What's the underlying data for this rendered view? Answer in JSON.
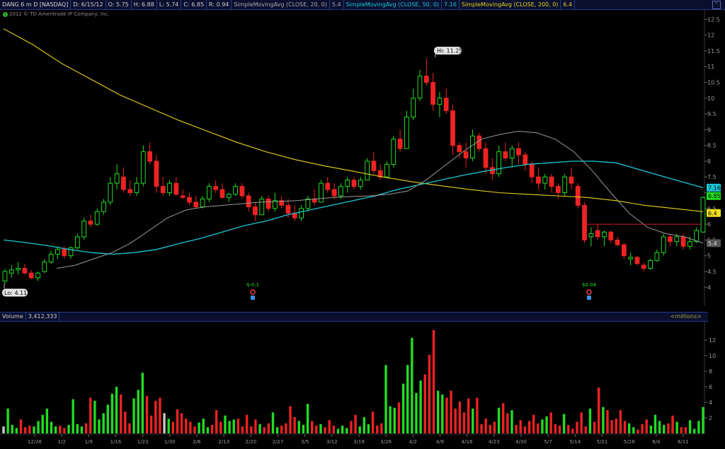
{
  "header": {
    "symbol": "DANG 6 m D [NASDAQ]",
    "date": "D: 6/15/12",
    "open": "O: 5.75",
    "high": "H: 6.88",
    "low": "L: 5.74",
    "close": "C: 6.85",
    "range": "R: 0.94",
    "sma20_label": "SimpleMovingAvg (CLOSE, 20, 0)",
    "sma20_value": "5.4",
    "sma50_label": "SimpleMovingAvg (CLOSE, 50, 0)",
    "sma50_value": "7.16",
    "sma200_label": "SimpleMovingAvg (CLOSE, 200, 0)",
    "sma200_value": "6.4",
    "copyright": "2012 © TD Ameritrade IP Company, Inc."
  },
  "volume_header": {
    "label": "Volume",
    "value": "3,412,333",
    "units": "<millions>"
  },
  "colors": {
    "up": "#22dd22",
    "down": "#ee2222",
    "sma20": "#9a9a9a",
    "sma50": "#19c7d4",
    "sma200": "#e6d21c",
    "level": "#cc2222"
  },
  "chart_data": [
    {
      "type": "line",
      "title": "DANG 6 m D [NASDAQ]",
      "xlabel": "",
      "ylabel": "",
      "x": [
        "12/26",
        "1/2",
        "1/9",
        "1/16",
        "1/23",
        "1/30",
        "2/6",
        "2/13",
        "2/20",
        "2/27",
        "3/5",
        "3/12",
        "3/19",
        "3/26",
        "4/2",
        "4/9",
        "4/16",
        "4/23",
        "4/30",
        "5/7",
        "5/14",
        "5/21",
        "5/28",
        "6/4",
        "6/11"
      ],
      "ylim": [
        3.4,
        12.8
      ],
      "yticks": [
        "4",
        "4.5",
        "5",
        "5.5",
        "6",
        "6.5",
        "7",
        "7.5",
        "8",
        "8.5",
        "9",
        "9.5",
        "10",
        "10.5",
        "11",
        "11.5",
        "12",
        "12.5"
      ],
      "candles": [
        [
          4.2,
          4.58,
          4.1,
          4.5
        ],
        [
          4.45,
          4.7,
          4.3,
          4.55
        ],
        [
          4.55,
          4.8,
          4.4,
          4.6
        ],
        [
          4.6,
          4.75,
          4.4,
          4.45
        ],
        [
          4.45,
          4.55,
          4.25,
          4.3
        ],
        [
          4.3,
          4.5,
          4.2,
          4.45
        ],
        [
          4.5,
          4.9,
          4.45,
          4.8
        ],
        [
          4.8,
          5.15,
          4.75,
          5.05
        ],
        [
          5.05,
          5.3,
          4.9,
          5.2
        ],
        [
          5.2,
          5.3,
          4.9,
          5.0
        ],
        [
          5.0,
          5.3,
          4.9,
          5.25
        ],
        [
          5.25,
          5.7,
          5.2,
          5.6
        ],
        [
          5.6,
          6.2,
          5.5,
          6.1
        ],
        [
          6.1,
          6.3,
          5.9,
          6.0
        ],
        [
          6.0,
          6.5,
          5.95,
          6.4
        ],
        [
          6.4,
          6.8,
          6.3,
          6.7
        ],
        [
          6.7,
          7.5,
          6.6,
          7.3
        ],
        [
          7.3,
          7.9,
          7.1,
          7.6
        ],
        [
          7.5,
          7.8,
          7.0,
          7.1
        ],
        [
          7.1,
          7.4,
          6.9,
          7.0
        ],
        [
          7.0,
          7.5,
          6.9,
          7.3
        ],
        [
          7.3,
          8.5,
          7.2,
          8.3
        ],
        [
          8.3,
          8.6,
          7.9,
          8.0
        ],
        [
          8.0,
          8.2,
          7.0,
          7.2
        ],
        [
          7.2,
          7.5,
          6.9,
          7.0
        ],
        [
          7.0,
          7.4,
          6.9,
          7.3
        ],
        [
          7.3,
          7.5,
          6.9,
          6.95
        ],
        [
          6.9,
          7.1,
          6.8,
          6.85
        ],
        [
          6.85,
          7.0,
          6.6,
          6.7
        ],
        [
          6.7,
          6.9,
          6.5,
          6.55
        ],
        [
          6.55,
          6.9,
          6.5,
          6.8
        ],
        [
          6.8,
          7.3,
          6.7,
          7.2
        ],
        [
          7.2,
          7.4,
          7.0,
          7.1
        ],
        [
          7.1,
          7.3,
          6.8,
          6.85
        ],
        [
          6.85,
          7.0,
          6.7,
          6.95
        ],
        [
          6.95,
          7.3,
          6.9,
          7.2
        ],
        [
          7.2,
          7.3,
          6.8,
          6.9
        ],
        [
          6.9,
          7.0,
          6.4,
          6.55
        ],
        [
          6.55,
          6.7,
          6.1,
          6.3
        ],
        [
          6.3,
          6.9,
          6.3,
          6.8
        ],
        [
          6.8,
          6.9,
          6.4,
          6.5
        ],
        [
          6.5,
          7.0,
          6.4,
          6.75
        ],
        [
          6.75,
          6.9,
          6.5,
          6.6
        ],
        [
          6.6,
          6.8,
          6.2,
          6.35
        ],
        [
          6.35,
          6.6,
          6.1,
          6.2
        ],
        [
          6.2,
          6.6,
          6.1,
          6.5
        ],
        [
          6.5,
          6.9,
          6.4,
          6.8
        ],
        [
          6.8,
          7.1,
          6.6,
          6.7
        ],
        [
          6.7,
          7.4,
          6.7,
          7.3
        ],
        [
          7.3,
          7.5,
          7.0,
          7.1
        ],
        [
          7.1,
          7.3,
          6.8,
          6.9
        ],
        [
          6.9,
          7.3,
          6.8,
          7.2
        ],
        [
          7.2,
          7.5,
          7.0,
          7.4
        ],
        [
          7.4,
          7.5,
          7.1,
          7.2
        ],
        [
          7.2,
          7.5,
          7.1,
          7.4
        ],
        [
          7.4,
          8.1,
          7.4,
          8.0
        ],
        [
          8.0,
          8.3,
          7.6,
          7.7
        ],
        [
          7.7,
          7.9,
          7.4,
          7.5
        ],
        [
          7.5,
          8.0,
          7.5,
          7.9
        ],
        [
          7.9,
          8.8,
          7.8,
          8.7
        ],
        [
          8.7,
          9.0,
          8.3,
          8.4
        ],
        [
          8.4,
          9.6,
          8.4,
          9.4
        ],
        [
          9.4,
          10.3,
          9.3,
          10.0
        ],
        [
          10.0,
          10.9,
          9.9,
          10.7
        ],
        [
          10.7,
          11.25,
          10.4,
          10.5
        ],
        [
          10.5,
          10.8,
          9.6,
          9.8
        ],
        [
          9.8,
          10.2,
          9.4,
          10.0
        ],
        [
          10.0,
          10.3,
          9.5,
          9.6
        ],
        [
          9.6,
          9.8,
          8.2,
          8.5
        ],
        [
          8.5,
          8.6,
          8.1,
          8.3
        ],
        [
          8.3,
          8.6,
          7.8,
          8.1
        ],
        [
          8.1,
          9.0,
          8.0,
          8.8
        ],
        [
          8.8,
          8.9,
          8.3,
          8.4
        ],
        [
          8.4,
          8.6,
          7.6,
          7.8
        ],
        [
          7.8,
          8.1,
          7.4,
          7.6
        ],
        [
          7.6,
          8.5,
          7.5,
          8.3
        ],
        [
          8.3,
          8.6,
          8.0,
          8.1
        ],
        [
          8.1,
          8.5,
          7.8,
          8.4
        ],
        [
          8.4,
          8.6,
          7.9,
          8.2
        ],
        [
          8.2,
          8.3,
          7.7,
          7.9
        ],
        [
          7.9,
          8.0,
          7.3,
          7.5
        ],
        [
          7.5,
          7.8,
          7.1,
          7.3
        ],
        [
          7.3,
          7.6,
          7.1,
          7.5
        ],
        [
          7.5,
          7.6,
          7.0,
          7.2
        ],
        [
          7.2,
          7.3,
          6.8,
          7.0
        ],
        [
          7.0,
          7.6,
          6.9,
          7.5
        ],
        [
          7.5,
          7.8,
          7.1,
          7.3
        ],
        [
          7.2,
          7.3,
          6.5,
          6.6
        ],
        [
          6.6,
          6.7,
          5.4,
          5.5
        ],
        [
          5.6,
          5.9,
          5.3,
          5.7
        ],
        [
          5.8,
          6.0,
          5.5,
          5.6
        ],
        [
          5.6,
          5.8,
          5.3,
          5.75
        ],
        [
          5.75,
          5.8,
          5.4,
          5.5
        ],
        [
          5.5,
          5.6,
          5.3,
          5.35
        ],
        [
          5.35,
          5.4,
          4.9,
          5.0
        ],
        [
          4.9,
          5.1,
          4.7,
          4.95
        ],
        [
          4.95,
          5.0,
          4.7,
          4.75
        ],
        [
          4.7,
          4.8,
          4.5,
          4.6
        ],
        [
          4.6,
          4.9,
          4.55,
          4.85
        ],
        [
          4.85,
          5.2,
          4.8,
          5.1
        ],
        [
          5.1,
          5.7,
          5.0,
          5.6
        ],
        [
          5.6,
          5.7,
          5.3,
          5.45
        ],
        [
          5.45,
          5.7,
          5.3,
          5.6
        ],
        [
          5.6,
          5.7,
          5.2,
          5.3
        ],
        [
          5.3,
          5.6,
          5.2,
          5.45
        ],
        [
          5.45,
          5.9,
          5.4,
          5.8
        ],
        [
          5.75,
          6.88,
          5.74,
          6.85
        ]
      ],
      "sma20": [
        4.6,
        4.7,
        4.9,
        5.1,
        5.4,
        5.8,
        6.2,
        6.45,
        6.55,
        6.6,
        6.65,
        6.7,
        6.72,
        6.75,
        6.8,
        6.85,
        6.88,
        6.9,
        6.95,
        7.05,
        7.4,
        7.85,
        8.3,
        8.7,
        8.85,
        8.95,
        8.9,
        8.7,
        8.3,
        7.7,
        7.0,
        6.35,
        5.9,
        5.7,
        5.6,
        5.4
      ],
      "sma50": [
        5.5,
        5.42,
        5.32,
        5.2,
        5.1,
        5.05,
        5.1,
        5.2,
        5.38,
        5.55,
        5.75,
        5.95,
        6.1,
        6.3,
        6.45,
        6.6,
        6.75,
        6.9,
        7.1,
        7.25,
        7.4,
        7.55,
        7.68,
        7.8,
        7.9,
        7.95,
        8.0,
        8.0,
        7.95,
        7.75,
        7.55,
        7.35,
        7.16
      ],
      "sma200": [
        12.2,
        11.7,
        11.1,
        10.6,
        10.1,
        9.7,
        9.3,
        8.95,
        8.6,
        8.3,
        8.05,
        7.85,
        7.68,
        7.5,
        7.35,
        7.22,
        7.1,
        7.0,
        6.95,
        6.9,
        6.85,
        6.75,
        6.6,
        6.5,
        6.4
      ],
      "level_line": 6.0,
      "labels": {
        "high": "Hi: 11.25",
        "low": "Lo: 4.11",
        "div1": "$-0.1",
        "div2": "$0.04"
      },
      "price_tags": [
        "7.16",
        "6.85",
        "6.4",
        "5.4"
      ]
    },
    {
      "type": "bar",
      "title": "Volume",
      "ylabel": "<millions>",
      "ylim": [
        0,
        14
      ],
      "yticks": [
        "2",
        "4",
        "6",
        "8",
        "10",
        "12"
      ],
      "values": [
        0.9,
        3.2,
        1.1,
        0.7,
        1.8,
        0.8,
        1.0,
        0.9,
        1.6,
        2.4,
        3.2,
        1.5,
        0.9,
        1.0,
        0.7,
        1.1,
        4.4,
        1.2,
        0.9,
        1.3,
        4.6,
        4.2,
        1.8,
        2.6,
        3.7,
        5.1,
        6.0,
        5.0,
        2.8,
        1.3,
        4.5,
        5.6,
        7.8,
        4.8,
        2.3,
        4.2,
        4.6,
        2.6,
        1.9,
        1.5,
        3.1,
        2.6,
        1.9,
        1.5,
        0.9,
        1.4,
        1.9,
        0.8,
        1.1,
        3.0,
        1.5,
        2.3,
        1.6,
        1.8,
        1.9,
        0.9,
        2.4,
        0.9,
        1.8,
        1.2,
        0.8,
        1.3,
        2.7,
        0.8,
        1.0,
        1.3,
        3.5,
        2.1,
        1.6,
        1.1,
        3.8,
        1.6,
        1.0,
        1.2,
        0.8,
        1.7,
        1.0,
        0.6,
        1.0,
        0.7,
        1.6,
        2.4,
        0.9,
        2.1,
        1.2,
        2.8,
        1.0,
        1.3,
        8.8,
        3.5,
        3.3,
        4.0,
        6.4,
        8.8,
        12.3,
        5.2,
        6.8,
        7.6,
        10.1,
        13.3,
        5.5,
        5.0,
        4.6,
        5.5,
        3.2,
        4.1,
        2.7,
        4.5,
        3.2,
        4.6,
        1.2,
        1.9,
        1.1,
        1.5,
        3.3,
        3.9,
        2.6,
        3.0,
        1.1,
        1.7,
        0.9,
        1.6,
        2.4,
        1.3,
        1.8,
        2.2,
        2.7,
        1.2,
        1.0,
        2.5,
        1.1,
        0.6,
        1.5,
        2.7,
        0.9,
        3.2,
        1.5,
        5.9,
        3.4,
        3.0,
        1.7,
        1.9,
        3.0,
        1.6,
        1.3,
        0.8,
        0.5,
        1.2,
        1.8,
        1.0,
        2.4,
        1.6,
        1.1,
        1.3,
        2.3,
        1.5,
        0.8,
        0.8,
        1.7,
        0.6,
        1.6,
        3.4
      ],
      "volume_last": 3.412
    }
  ],
  "xaxis_labels": [
    "12/26",
    "1/2",
    "1/9",
    "1/16",
    "1/23",
    "1/30",
    "2/6",
    "2/13",
    "2/20",
    "2/27",
    "3/5",
    "3/12",
    "3/19",
    "3/26",
    "4/2",
    "4/9",
    "4/16",
    "4/23",
    "4/30",
    "5/7",
    "5/14",
    "5/21",
    "5/28",
    "6/4",
    "6/11"
  ]
}
